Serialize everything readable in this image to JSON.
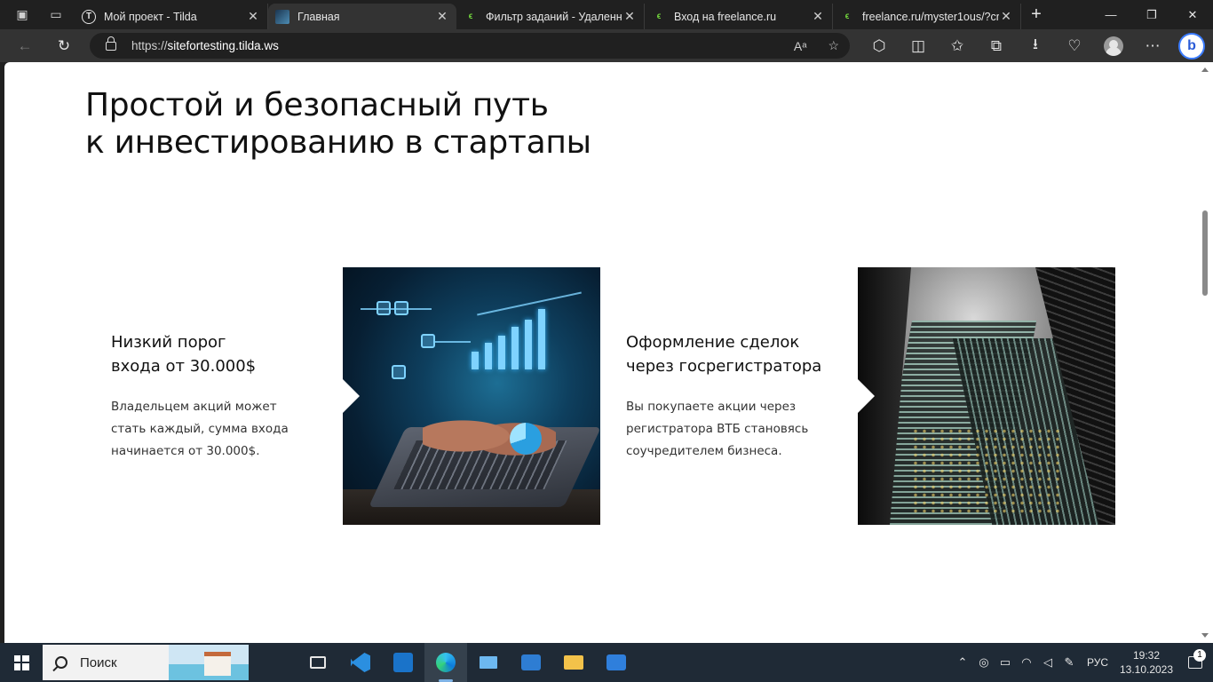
{
  "browser": {
    "tabs": [
      {
        "title": "Мой проект - Tilda",
        "icon": "tilda-favicon"
      },
      {
        "title": "Главная",
        "icon": "site-favicon"
      },
      {
        "title": "Фильтр заданий - Удаленн",
        "icon": "freelance-favicon"
      },
      {
        "title": "Вход на freelance.ru",
        "icon": "freelance-favicon"
      },
      {
        "title": "freelance.ru/myster1ous/?cr",
        "icon": "freelance-favicon"
      }
    ],
    "url_prefix": "https://",
    "url_host": "sitefortesting.tilda.ws",
    "read_aloud_label": "Aᵃ"
  },
  "page": {
    "heading_line1": "Простой и безопасный путь",
    "heading_line2": "к инвестированию в стартапы",
    "features": [
      {
        "title_line1": "Низкий порог",
        "title_line2": "входа от 30.000$",
        "text_line1": "Владельцем акций может",
        "text_line2": "стать каждый, сумма входа",
        "text_line3": "начинается от 30.000$."
      },
      {
        "title_line1": "Оформление сделок",
        "title_line2": "через госрегистратора",
        "text_line1": "Вы покупаете акции через",
        "text_line2": "регистратора ВТБ становясь",
        "text_line3": "соучредителем бизнеса."
      }
    ]
  },
  "taskbar": {
    "search_placeholder": "Поиск",
    "language": "РУС",
    "time": "19:32",
    "date": "13.10.2023",
    "notification_count": "1"
  },
  "colors": {
    "browser_bg": "#202020",
    "toolbar_bg": "#333333",
    "taskbar_bg": "#1f2a36",
    "accent_green": "#6fd13b"
  }
}
